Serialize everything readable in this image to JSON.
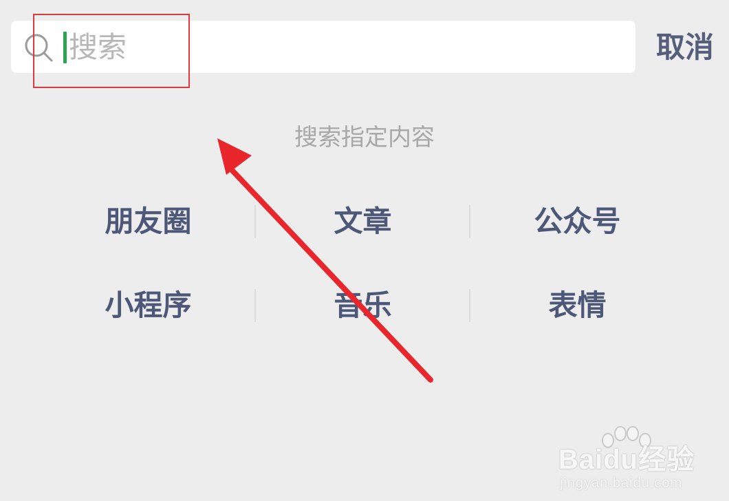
{
  "search": {
    "placeholder": "搜索",
    "value": "",
    "cancel_label": "取消"
  },
  "section": {
    "title": "搜索指定内容"
  },
  "categories": [
    {
      "label": "朋友圈"
    },
    {
      "label": "文章"
    },
    {
      "label": "公众号"
    },
    {
      "label": "小程序"
    },
    {
      "label": "音乐"
    },
    {
      "label": "表情"
    }
  ],
  "annotation": {
    "box_color": "#e0393d",
    "arrow_color": "#e8262b"
  },
  "watermark": {
    "brand_text": "Baidu",
    "suffix": "经验",
    "url": "jingyan.baidu.com"
  },
  "colors": {
    "background": "#ededed",
    "cursor": "#2aa44f",
    "link": "#4d5878"
  }
}
